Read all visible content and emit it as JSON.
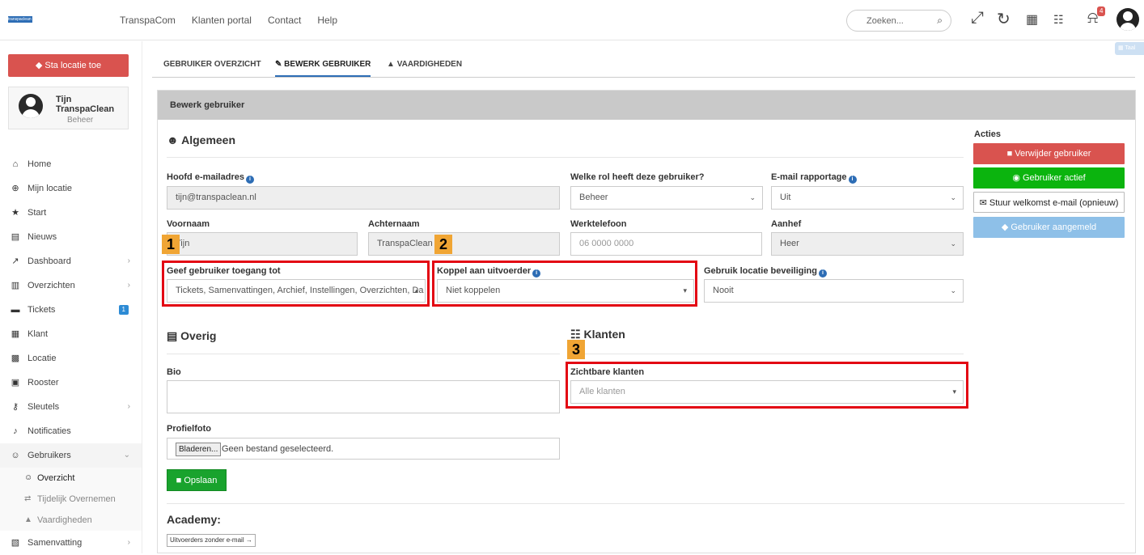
{
  "topbar": {
    "logo_text": "transpaclean",
    "nav": [
      "TranspaCom",
      "Klanten portal",
      "Contact",
      "Help"
    ],
    "search_placeholder": "Zoeken...",
    "notification_count": "4"
  },
  "sidebar": {
    "location_button": "Sta locatie toe",
    "user": {
      "first_name": "Tijn",
      "company": "TranspaClean",
      "role": "Beheer"
    },
    "menu": [
      {
        "label": "Home",
        "icon": "home-icon"
      },
      {
        "label": "Mijn locatie",
        "icon": "globe-icon"
      },
      {
        "label": "Start",
        "icon": "star-icon"
      },
      {
        "label": "Nieuws",
        "icon": "newspaper-icon"
      },
      {
        "label": "Dashboard",
        "icon": "chart-icon"
      },
      {
        "label": "Overzichten",
        "icon": "file-icon"
      },
      {
        "label": "Tickets",
        "icon": "comment-icon",
        "count": "1"
      },
      {
        "label": "Klant",
        "icon": "building-icon"
      },
      {
        "label": "Locatie",
        "icon": "location-building-icon"
      },
      {
        "label": "Rooster",
        "icon": "calendar-icon"
      },
      {
        "label": "Sleutels",
        "icon": "key-icon"
      },
      {
        "label": "Notificaties",
        "icon": "bell-icon"
      },
      {
        "label": "Gebruikers",
        "icon": "users-icon"
      },
      {
        "label": "Samenvatting",
        "icon": "summary-icon"
      }
    ],
    "submenu": [
      "Overzicht",
      "Tijdelijk Overnemen",
      "Vaardigheden"
    ]
  },
  "tabs": [
    "GEBRUIKER OVERZICHT",
    "BEWERK GEBRUIKER",
    "VAARDIGHEDEN"
  ],
  "panel": {
    "title": "Bewerk gebruiker",
    "algemeen": "Algemeen",
    "labels": {
      "email": "Hoofd e-mailadres",
      "rol": "Welke rol heeft deze gebruiker?",
      "rapportage": "E-mail rapportage",
      "voornaam": "Voornaam",
      "achternaam": "Achternaam",
      "werktelefoon": "Werktelefoon",
      "aanhef": "Aanhef",
      "toegang": "Geef gebruiker toegang tot",
      "koppel": "Koppel aan uitvoerder",
      "beveiliging": "Gebruik locatie beveiliging"
    },
    "values": {
      "email": "tijn@transpaclean.nl",
      "rol": "Beheer",
      "rapportage": "Uit",
      "voornaam": "Tijn",
      "achternaam": "TranspaClean",
      "werktelefoon_placeholder": "06 0000 0000",
      "aanhef": "Heer",
      "toegang": "Tickets, Samenvattingen, Archief, Instellingen, Overzichten, Da",
      "koppel": "Niet koppelen",
      "beveiliging": "Nooit"
    },
    "overig": "Overig",
    "bio_label": "Bio",
    "profielfoto_label": "Profielfoto",
    "file_button": "Bladeren...",
    "file_text": "Geen bestand geselecteerd.",
    "save": "Opslaan",
    "klanten": "Klanten",
    "zichtbare_label": "Zichtbare klanten",
    "zichtbare_placeholder": "Alle klanten",
    "academy": "Academy:",
    "academy_button": "Uitvoerders zonder e-mail →"
  },
  "acties": {
    "title": "Acties",
    "delete": "Verwijder gebruiker",
    "active": "Gebruiker actief",
    "welcome": "Stuur welkomst e-mail (opnieuw)",
    "registered": "Gebruiker aangemeld"
  },
  "annotations": [
    "1",
    "2",
    "3"
  ],
  "colors": {
    "primary": "#2d6db5",
    "danger": "#d9534f",
    "success": "#19a32d",
    "highlight": "#e30613",
    "marker": "#f0a534"
  }
}
